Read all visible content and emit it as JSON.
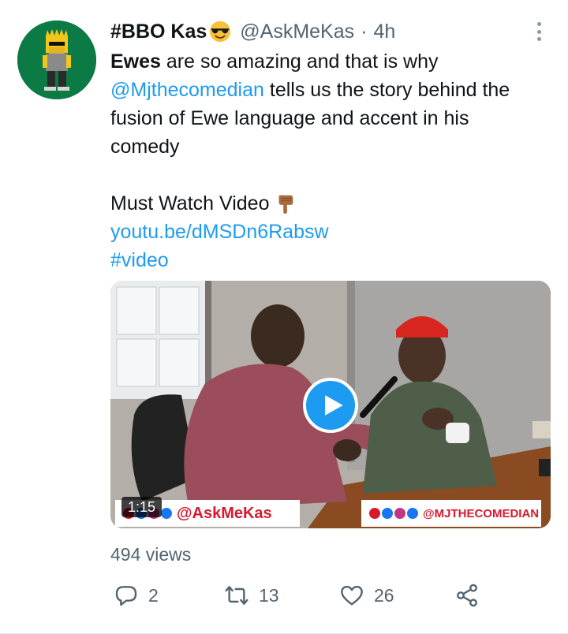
{
  "tweet": {
    "author": {
      "display_name": "#BBO Kas",
      "name_emoji": "smiling-face-with-sunglasses-icon",
      "handle": "@AskMeKas",
      "separator": "·",
      "time": "4h"
    },
    "text": {
      "line1_bold": "Ewes",
      "line1_rest": " are so amazing and that is why",
      "line2_mention": "@Mjthecomedian",
      "line2_rest": " tells us the story behind the",
      "line3": "fusion of Ewe language and accent in his",
      "line4": "comedy",
      "line5": "Must Watch Video",
      "line5_emoji": "backhand-index-pointing-down-icon",
      "link": "youtu.be/dMSDn6Rabsw",
      "hashtag": "#video"
    },
    "video": {
      "duration": "1:15",
      "watermark_left": "@AskMeKas",
      "watermark_right": "@MJTHECOMEDIAN",
      "play_icon": "play-icon"
    },
    "views": "494 views",
    "actions": {
      "replies": "2",
      "retweets": "13",
      "likes": "26"
    }
  },
  "colors": {
    "link": "#1d9bf0",
    "secondary_text": "#536471",
    "avatar_bg": "#0c7a45",
    "watermark_red": "#d8192d"
  }
}
